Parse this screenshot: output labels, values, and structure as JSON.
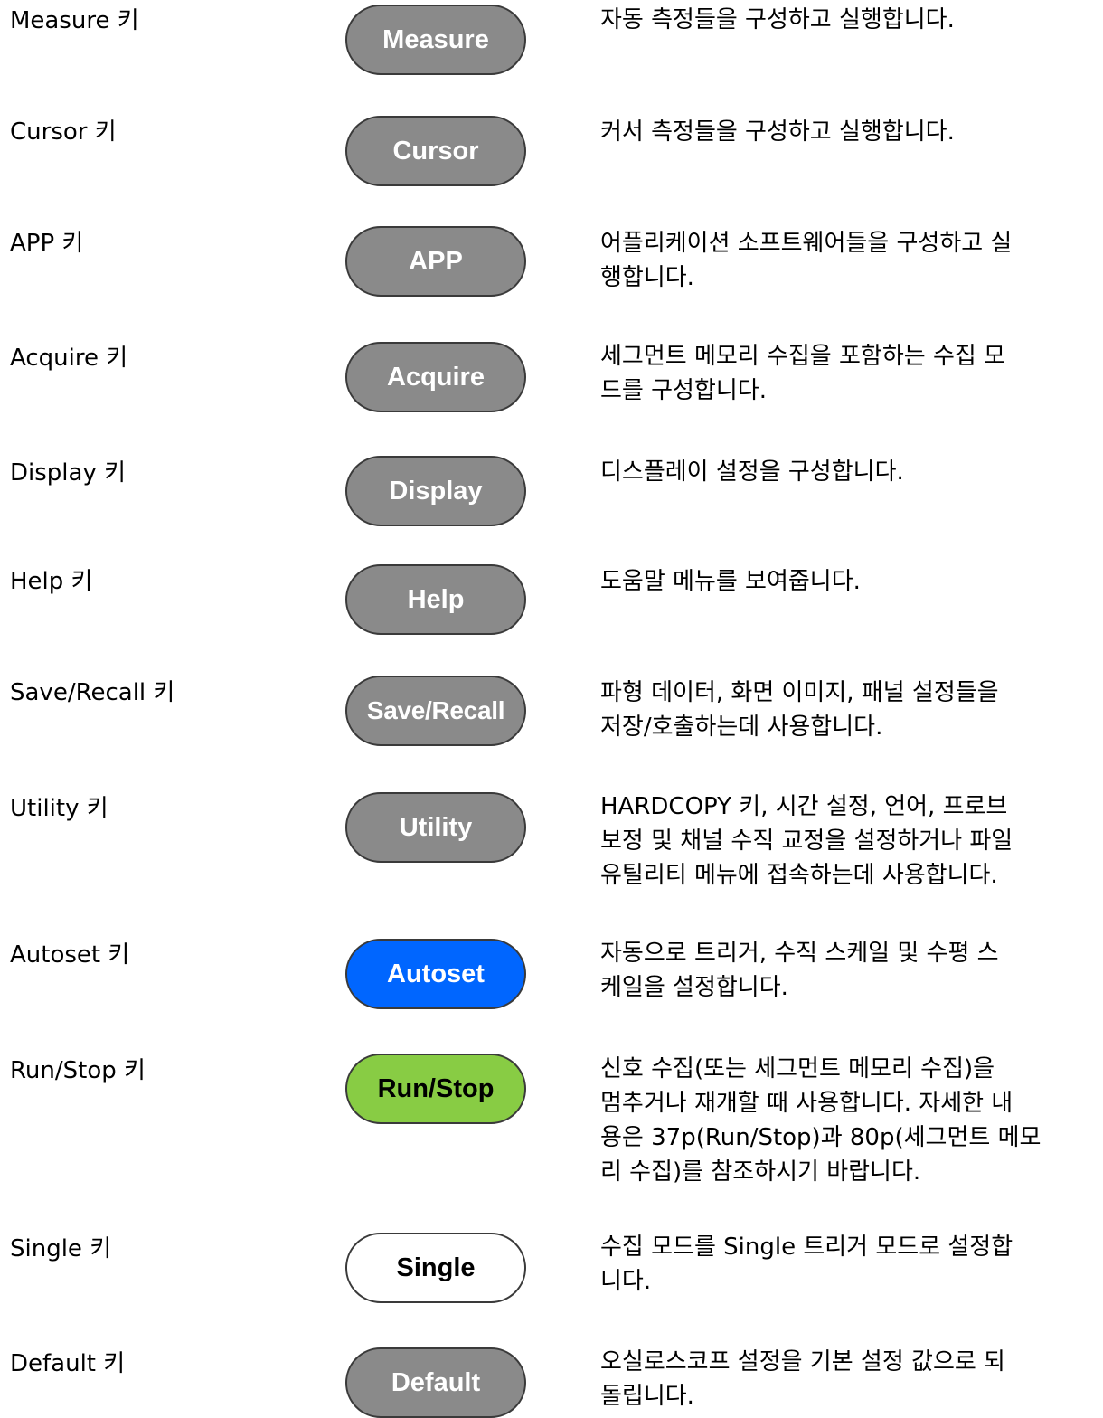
{
  "keys": [
    {
      "name": "Measure 키",
      "button": "Measure",
      "style": "gray",
      "desc": [
        "자동 측정들을 구성하고 실행합니다."
      ]
    },
    {
      "name": "Cursor 키",
      "button": "Cursor",
      "style": "gray",
      "desc": [
        "커서 측정들을 구성하고 실행합니다."
      ]
    },
    {
      "name": "APP 키",
      "button": "APP",
      "style": "gray",
      "desc": [
        "어플리케이션 소프트웨어들을 구성하고 실",
        "행합니다."
      ]
    },
    {
      "name": "Acquire 키",
      "button": "Acquire",
      "style": "gray",
      "desc": [
        "세그먼트 메모리 수집을 포함하는 수집 모",
        "드를 구성합니다."
      ]
    },
    {
      "name": "Display 키",
      "button": "Display",
      "style": "gray",
      "desc": [
        "디스플레이 설정을 구성합니다."
      ]
    },
    {
      "name": "Help 키",
      "button": "Help",
      "style": "gray",
      "desc": [
        "도움말 메뉴를 보여줍니다."
      ]
    },
    {
      "name": "Save/Recall 키",
      "button": "Save/Recall",
      "style": "gray",
      "desc": [
        "파형 데이터, 화면 이미지, 패널 설정들을",
        "저장/호출하는데 사용합니다."
      ]
    },
    {
      "name": "Utility 키",
      "button": "Utility",
      "style": "gray",
      "desc": [
        "HARDCOPY 키, 시간 설정, 언어, 프로브",
        "보정 및 채널 수직 교정을 설정하거나 파일",
        "유틸리티 메뉴에 접속하는데 사용합니다."
      ]
    },
    {
      "name": "Autoset 키",
      "button": "Autoset",
      "style": "blue",
      "desc": [
        "자동으로 트리거, 수직 스케일 및 수평 스",
        "케일을 설정합니다."
      ]
    },
    {
      "name": "Run/Stop 키",
      "button": "Run/Stop",
      "style": "green",
      "desc": [
        "신호 수집(또는 세그먼트 메모리 수집)을",
        "멈추거나 재개할 때 사용합니다. 자세한 내",
        "용은 37p(Run/Stop)과 80p(세그먼트 메모",
        "리 수집)를 참조하시기 바랍니다."
      ]
    },
    {
      "name": "Single 키",
      "button": "Single",
      "style": "white",
      "desc": [
        "수집 모드를 Single 트리거 모드로 설정합",
        "니다."
      ]
    },
    {
      "name": "Default 키",
      "button": "Default",
      "style": "gray",
      "desc": [
        "오실로스코프 설정을 기본 설정 값으로 되",
        "돌립니다."
      ]
    }
  ],
  "colors": {
    "gray_button": "#8a8a8a",
    "autoset_button": "#0066ff",
    "runstop_button": "#88cc44",
    "single_button": "#ffffff"
  }
}
